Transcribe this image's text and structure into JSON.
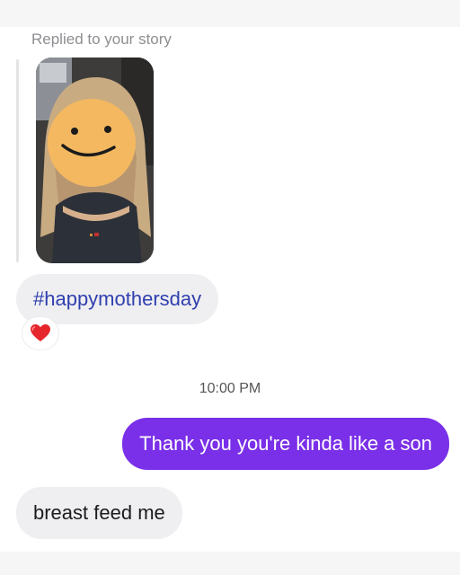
{
  "story_reply": {
    "label": "Replied to your story",
    "thumbnail_icon": "smiley-face-censor-icon"
  },
  "messages": [
    {
      "from": "them",
      "text": "#happymothersday",
      "reaction": "heart-emoji-icon"
    },
    {
      "timestamp": "10:00 PM"
    },
    {
      "from": "me",
      "text": "Thank you you're kinda like a son"
    },
    {
      "from": "them",
      "text": "breast feed me"
    }
  ],
  "colors": {
    "sent_bubble": "#7a2fe8",
    "received_bubble": "#efeff1",
    "hashtag_text": "#2f3fae",
    "muted_text": "#8e8e93",
    "censor_face": "#f4b860"
  }
}
